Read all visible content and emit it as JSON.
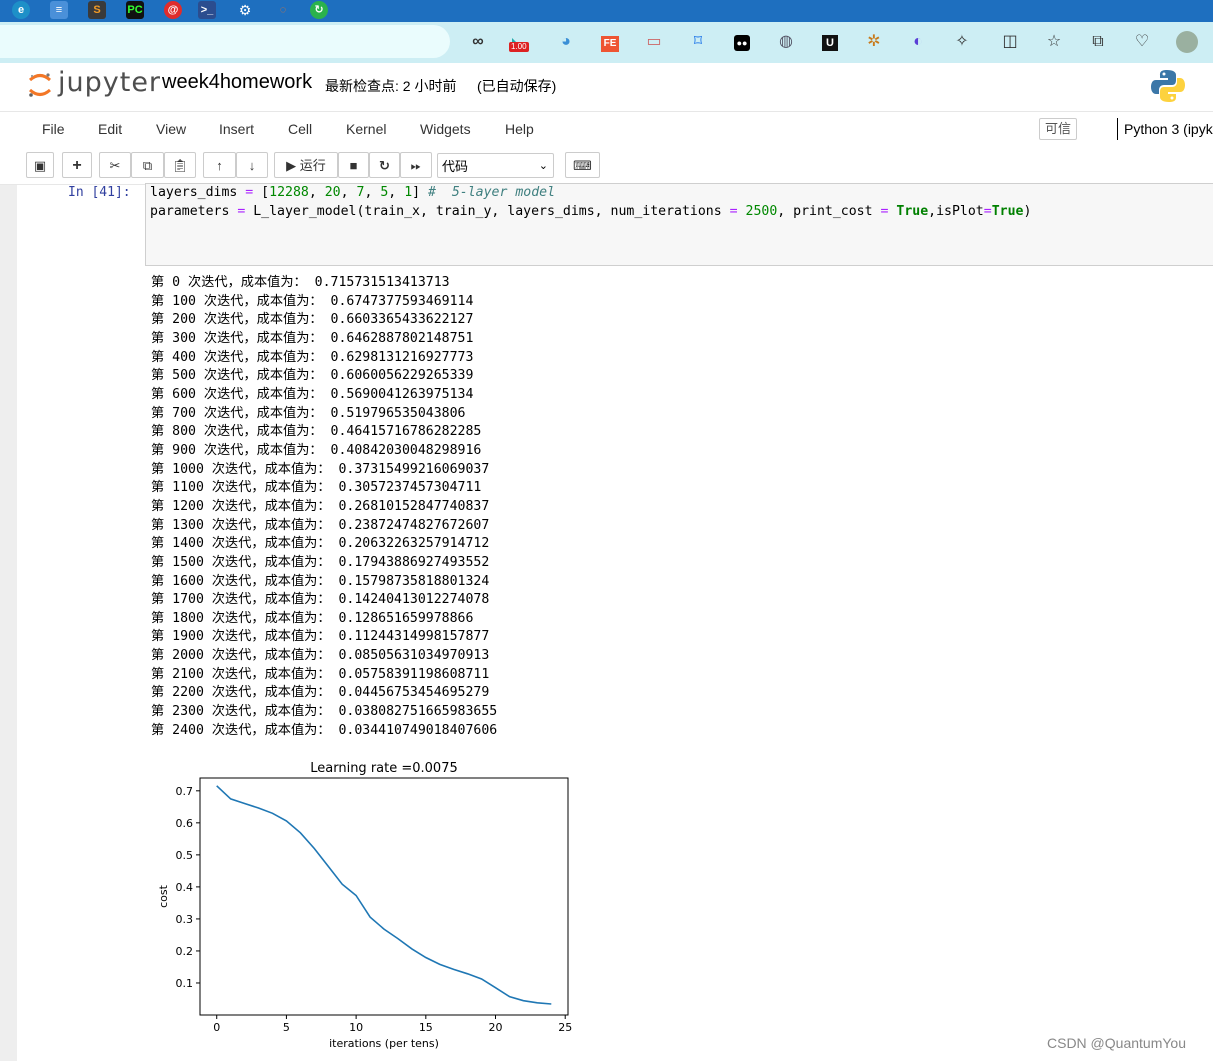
{
  "notebook": {
    "logo_text": "jupyter",
    "name": "week4homework",
    "checkpoint": "最新检查点: 2 小时前",
    "autosave": "(已自动保存)"
  },
  "menu": {
    "items": [
      "File",
      "Edit",
      "View",
      "Insert",
      "Cell",
      "Kernel",
      "Widgets",
      "Help"
    ],
    "trusted": "可信",
    "kernel": "Python 3 (ipyk"
  },
  "toolbar": {
    "run_label": "运行",
    "cell_type": "代码"
  },
  "browser": {
    "zoom_badge": "1.00"
  },
  "cell": {
    "prompt": "In  [41]:",
    "code_lines": [
      "layers_dims = [12288, 20, 7, 5, 1] #  5-layer model",
      "parameters = L_layer_model(train_x, train_y, layers_dims, num_iterations = 2500, print_cost = True,isPlot=True)"
    ],
    "output_lines": [
      "第 0 次迭代，成本值为： 0.715731513413713",
      "第 100 次迭代，成本值为： 0.6747377593469114",
      "第 200 次迭代，成本值为： 0.6603365433622127",
      "第 300 次迭代，成本值为： 0.6462887802148751",
      "第 400 次迭代，成本值为： 0.6298131216927773",
      "第 500 次迭代，成本值为： 0.6060056229265339",
      "第 600 次迭代，成本值为： 0.5690041263975134",
      "第 700 次迭代，成本值为： 0.519796535043806",
      "第 800 次迭代，成本值为： 0.46415716786282285",
      "第 900 次迭代，成本值为： 0.40842030048298916",
      "第 1000 次迭代，成本值为： 0.37315499216069037",
      "第 1100 次迭代，成本值为： 0.3057237457304711",
      "第 1200 次迭代，成本值为： 0.26810152847740837",
      "第 1300 次迭代，成本值为： 0.23872474827672607",
      "第 1400 次迭代，成本值为： 0.20632263257914712",
      "第 1500 次迭代，成本值为： 0.17943886927493552",
      "第 1600 次迭代，成本值为： 0.15798735818801324",
      "第 1700 次迭代，成本值为： 0.14240413012274078",
      "第 1800 次迭代，成本值为： 0.128651659978866",
      "第 1900 次迭代，成本值为： 0.11244314998157877",
      "第 2000 次迭代，成本值为： 0.08505631034970913",
      "第 2100 次迭代，成本值为： 0.05758391198608711",
      "第 2200 次迭代，成本值为： 0.04456753454695279",
      "第 2300 次迭代，成本值为： 0.038082751665983655",
      "第 2400 次迭代，成本值为： 0.034410749018407606"
    ]
  },
  "chart_data": {
    "type": "line",
    "title": "Learning rate =0.0075",
    "xlabel": "iterations (per tens)",
    "ylabel": "cost",
    "xlim": [
      -1.2,
      25.2
    ],
    "ylim": [
      0.0,
      0.74
    ],
    "xticks": [
      0,
      5,
      10,
      15,
      20,
      25
    ],
    "yticks": [
      0.1,
      0.2,
      0.3,
      0.4,
      0.5,
      0.6,
      0.7
    ],
    "grid": false,
    "color": "#1f77b4",
    "x": [
      0,
      1,
      2,
      3,
      4,
      5,
      6,
      7,
      8,
      9,
      10,
      11,
      12,
      13,
      14,
      15,
      16,
      17,
      18,
      19,
      20,
      21,
      22,
      23,
      24
    ],
    "y": [
      0.7157,
      0.6747,
      0.6603,
      0.6463,
      0.6298,
      0.606,
      0.569,
      0.5198,
      0.4642,
      0.4084,
      0.3732,
      0.3057,
      0.2681,
      0.2387,
      0.2063,
      0.1794,
      0.158,
      0.1424,
      0.1287,
      0.1124,
      0.0851,
      0.0576,
      0.0446,
      0.0381,
      0.0344
    ]
  },
  "watermark": "CSDN @QuantumYou",
  "colors": {
    "taskbar": "#1e6fbf",
    "browser_bar": "#cdeef4",
    "prompt_blue": "#303f9f",
    "jupyter_orange": "#f37726"
  }
}
